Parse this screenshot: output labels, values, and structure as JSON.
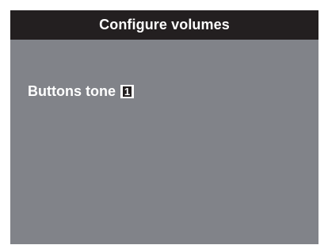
{
  "header": {
    "title": "Configure volumes"
  },
  "menu": {
    "items": [
      {
        "label": "Buttons tone",
        "value": "1"
      }
    ]
  },
  "colors": {
    "screen_bg": "#818389",
    "title_bar_bg": "#231f20",
    "text": "#ffffff"
  }
}
